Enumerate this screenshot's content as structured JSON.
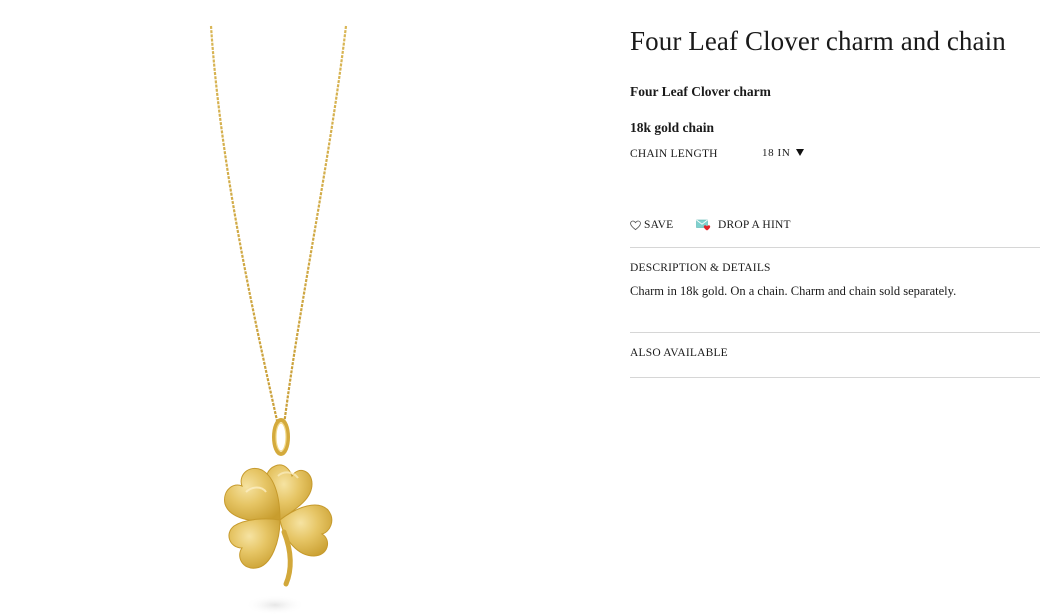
{
  "product": {
    "title": "Four Leaf Clover charm and chain",
    "charm_name": "Four Leaf Clover charm",
    "chain_name": "18k gold chain",
    "chain_length_label": "CHAIN LENGTH",
    "chain_length_value": "18 IN",
    "image_icon": "four-leaf-clover-pendant"
  },
  "actions": {
    "save_label": "SAVE",
    "save_icon": "heart-outline-icon",
    "hint_label": "DROP A HINT",
    "hint_icon": "envelope-heart-icon"
  },
  "description": {
    "heading": "DESCRIPTION & DETAILS",
    "text": "Charm in 18k gold. On a chain. Charm and chain sold separately."
  },
  "also_available": {
    "label": "ALSO AVAILABLE"
  },
  "colors": {
    "gold": "#e2c15a",
    "hint_envelope": "#7fd1cf",
    "hint_heart": "#e0232b",
    "divider": "#d6d6d6"
  }
}
